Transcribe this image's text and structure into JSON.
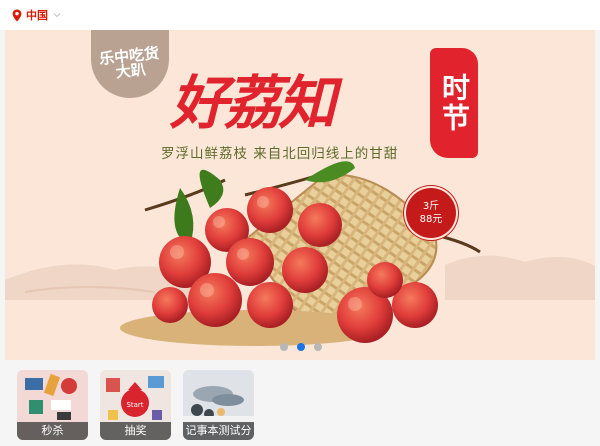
{
  "location": {
    "text": "中国",
    "pin_icon": "location-pin-icon",
    "dropdown_icon": "chevron-down-icon",
    "color": "#d81e06"
  },
  "banner": {
    "badge_text": "乐中吃货大趴",
    "headline": "好荔知",
    "seal_text": "时节",
    "subline": "罗浮山鲜荔枝 来自北回归线上的甘甜",
    "price_qty": "3斤",
    "price_amount": "88元",
    "slides_count": 3,
    "active_slide": 2,
    "accent_color": "#e0232c",
    "background_color": "#fbe6d8"
  },
  "tiles": [
    {
      "label": "秒杀"
    },
    {
      "label": "抽奖",
      "image_text": "Start"
    },
    {
      "label": "记事本测试分"
    }
  ]
}
